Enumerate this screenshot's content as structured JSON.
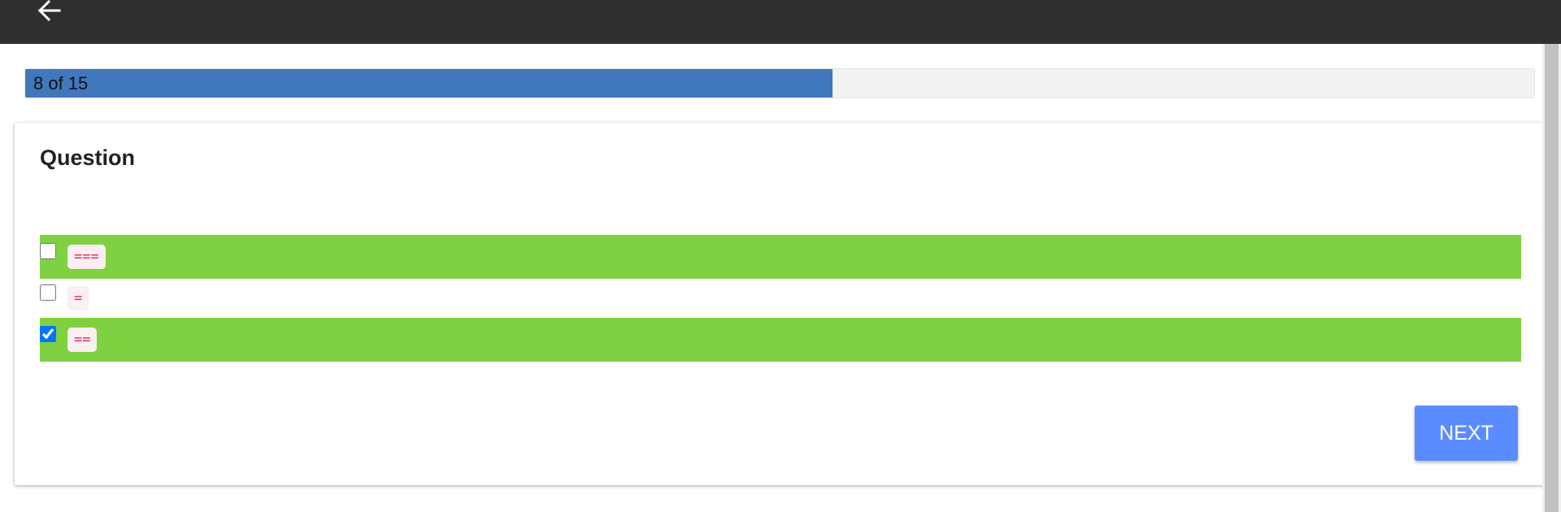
{
  "header": {
    "back_icon": "arrow-left-icon"
  },
  "progress": {
    "label": "8 of 15",
    "current": 8,
    "total": 15,
    "fill_fraction": 0.535,
    "color": "#4178bc"
  },
  "question": {
    "title": "Question",
    "options": [
      {
        "code": "===",
        "checked": false,
        "highlight": "correct"
      },
      {
        "code": "=",
        "checked": false,
        "highlight": "none"
      },
      {
        "code": "==",
        "checked": true,
        "highlight": "correct"
      }
    ]
  },
  "actions": {
    "next_label": "NEXT"
  },
  "colors": {
    "correct_bg": "#7fd141",
    "next_button": "#5b8cff",
    "topbar": "#2f2f2f"
  }
}
